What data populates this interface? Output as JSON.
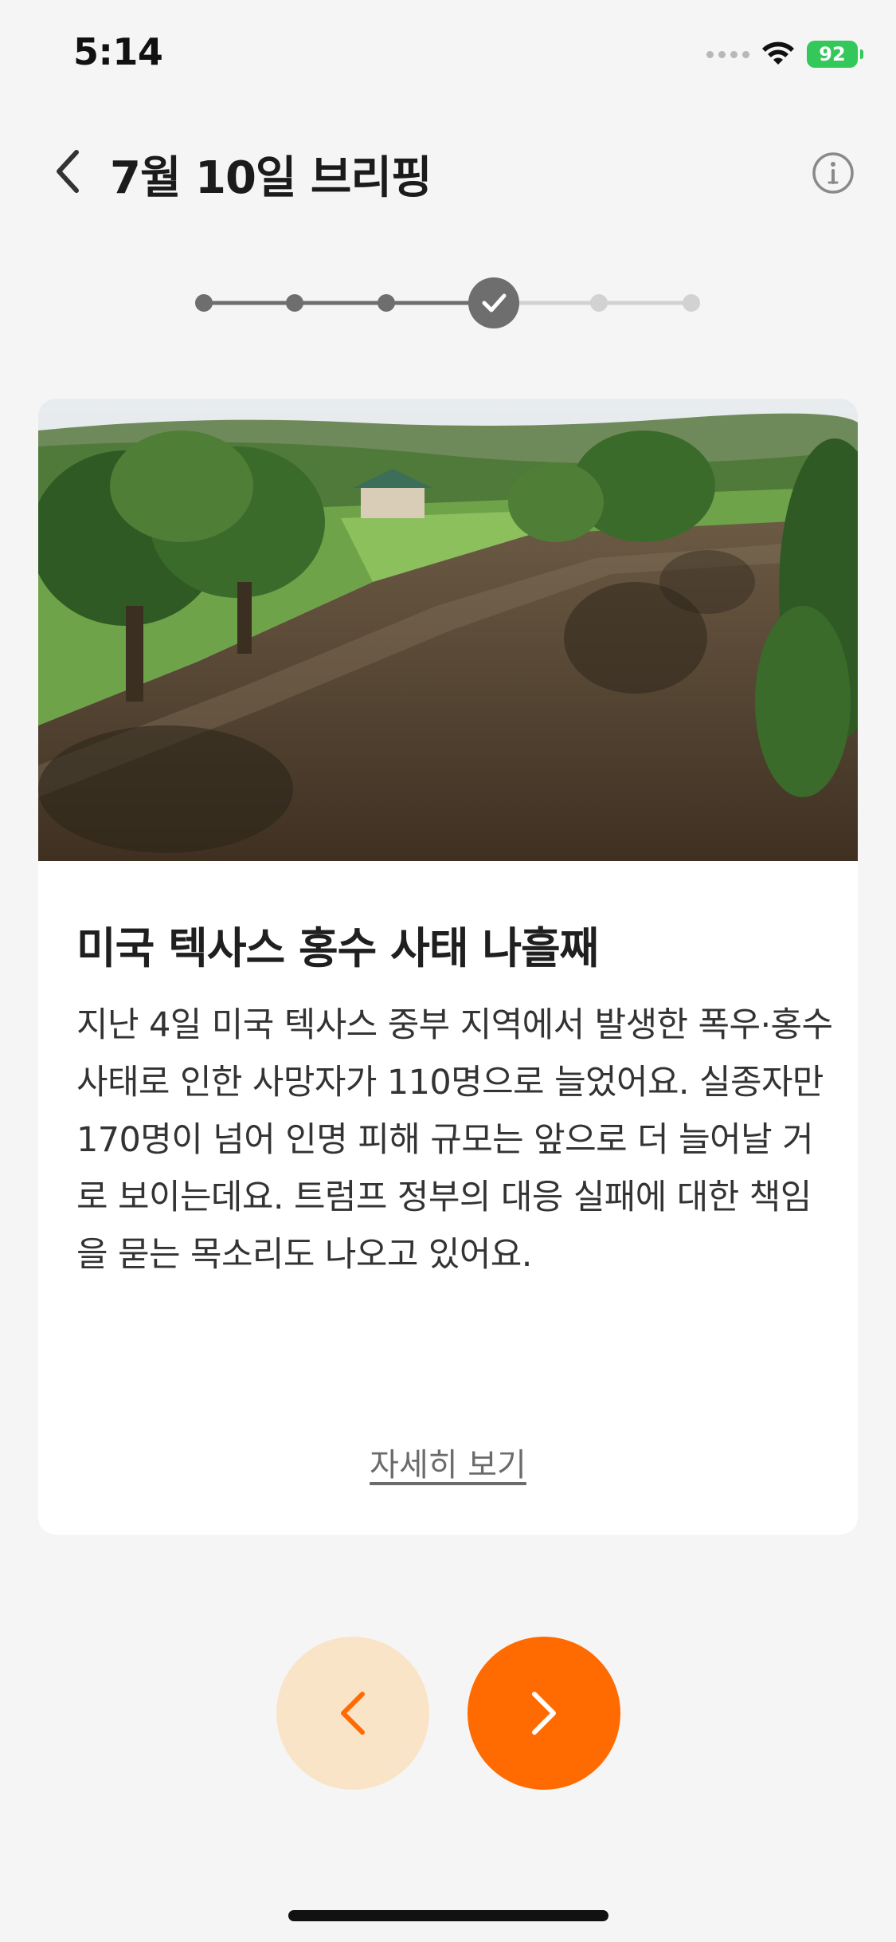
{
  "status_bar": {
    "time": "5:14",
    "battery": "92"
  },
  "header": {
    "title": "7월 10일 브리핑",
    "back_icon": "chevron-left-icon",
    "info_icon": "info-circle-icon"
  },
  "progress": {
    "total_steps": 6,
    "current_step": 4
  },
  "article": {
    "image_alt": "flooded river with trees and a house",
    "title": "미국 텍사스 홍수 사태 나흘째",
    "body": "지난 4일 미국 텍사스 중부 지역에서 발생한 폭우·홍수 사태로 인한 사망자가 110명으로 늘었어요. 실종자만 170명이 넘어 인명 피해 규모는 앞으로 더 늘어날 거로 보이는데요. 트럼프 정부의 대응 실패에 대한 책임을 묻는 목소리도 나오고 있어요.",
    "more_link": "자세히 보기"
  },
  "navigation": {
    "prev_icon": "chevron-left-icon",
    "next_icon": "chevron-right-icon"
  },
  "colors": {
    "accent": "#ff6b00",
    "accent_light": "#fae4c8",
    "stepper_done": "#6e6e6e",
    "stepper_todo": "#d2d2d2",
    "background": "#f5f5f5"
  }
}
